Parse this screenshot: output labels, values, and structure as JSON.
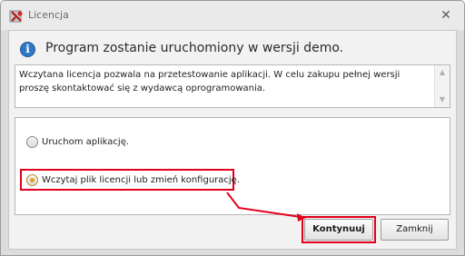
{
  "window": {
    "title": "Licencja",
    "close_glyph": "✕",
    "app_icon": "license-app-icon"
  },
  "header": {
    "info_icon_glyph": "i",
    "text": "Program zostanie uruchomiony w wersji demo."
  },
  "description": {
    "text": "Wczytana licencja pozwala na przetestowanie aplikacji. W celu zakupu pełnej wersji proszę skontaktować się z wydawcą oprogramowania."
  },
  "options": [
    {
      "label": "Uruchom aplikację.",
      "checked": false
    },
    {
      "label": "Wczytaj plik licencji lub zmień konfigurację.",
      "checked": true
    }
  ],
  "buttons": {
    "continue_label": "Kontynuuj",
    "close_label": "Zamknij"
  },
  "colors": {
    "highlight": "#e2001a",
    "info_icon": "#2f78c4",
    "radio_checked": "#e3a21a"
  }
}
